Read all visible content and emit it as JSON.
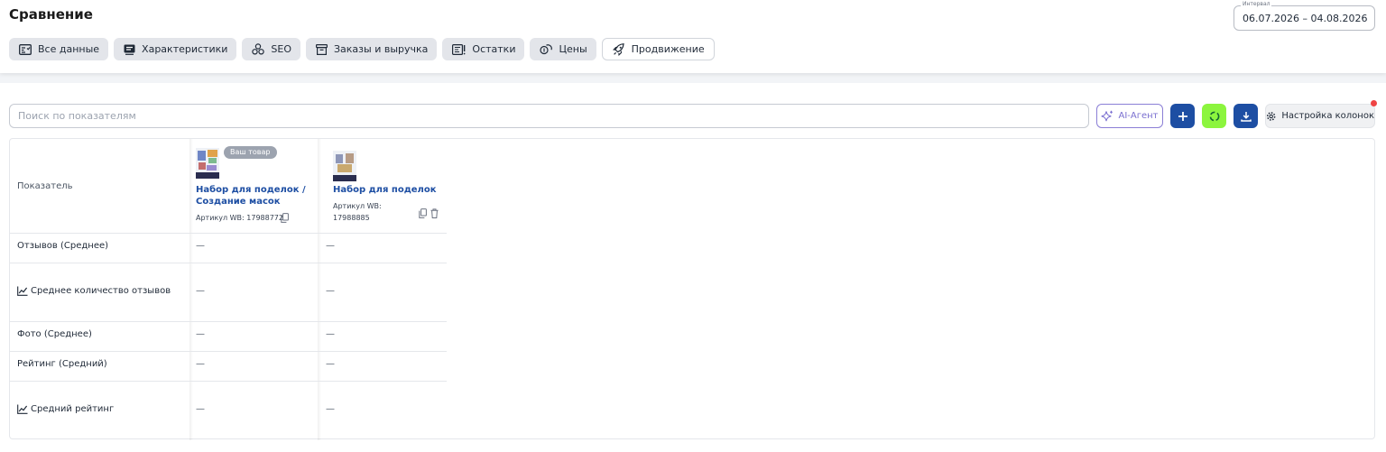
{
  "page": {
    "title": "Сравнение"
  },
  "interval": {
    "label": "Интервал",
    "value": "06.07.2026 – 04.08.2026"
  },
  "tabs": [
    {
      "label": "Все данные",
      "icon": "table-icon"
    },
    {
      "label": "Характеристики",
      "icon": "list-icon"
    },
    {
      "label": "SEO",
      "icon": "seo-icon"
    },
    {
      "label": "Заказы и выручка",
      "icon": "archive-icon"
    },
    {
      "label": "Остатки",
      "icon": "stock-icon"
    },
    {
      "label": "Цены",
      "icon": "coins-icon"
    },
    {
      "label": "Продвижение",
      "icon": "rocket-icon",
      "active": true
    }
  ],
  "search": {
    "placeholder": "Поиск по показателям",
    "value": ""
  },
  "toolbar": {
    "ai_label": "AI-Агент",
    "columns_label": "Настройка колонок",
    "colors": {
      "primary": "#1d4ea3",
      "refresh": "#8cf53e",
      "notify": "#ef4444"
    }
  },
  "table": {
    "header_label": "Показатель",
    "products": [
      {
        "badge": "Ваш товар",
        "title": "Набор для поделок / Создание масок",
        "article": "Артикул WB: 17988772"
      },
      {
        "badge": "",
        "title": "Набор для поделок",
        "article": "Артикул WB: 17988885"
      }
    ],
    "rows": [
      {
        "label": "Отзывов (Среднее)",
        "chart_icon": false,
        "values": [
          "—",
          "—"
        ]
      },
      {
        "label": "Среднее количество отзывов",
        "chart_icon": true,
        "values": [
          "—",
          "—"
        ]
      },
      {
        "label": "Фото (Среднее)",
        "chart_icon": false,
        "values": [
          "—",
          "—"
        ]
      },
      {
        "label": "Рейтинг (Средний)",
        "chart_icon": false,
        "values": [
          "—",
          "—"
        ]
      },
      {
        "label": "Средний рейтинг",
        "chart_icon": true,
        "values": [
          "—",
          "—"
        ]
      }
    ]
  }
}
